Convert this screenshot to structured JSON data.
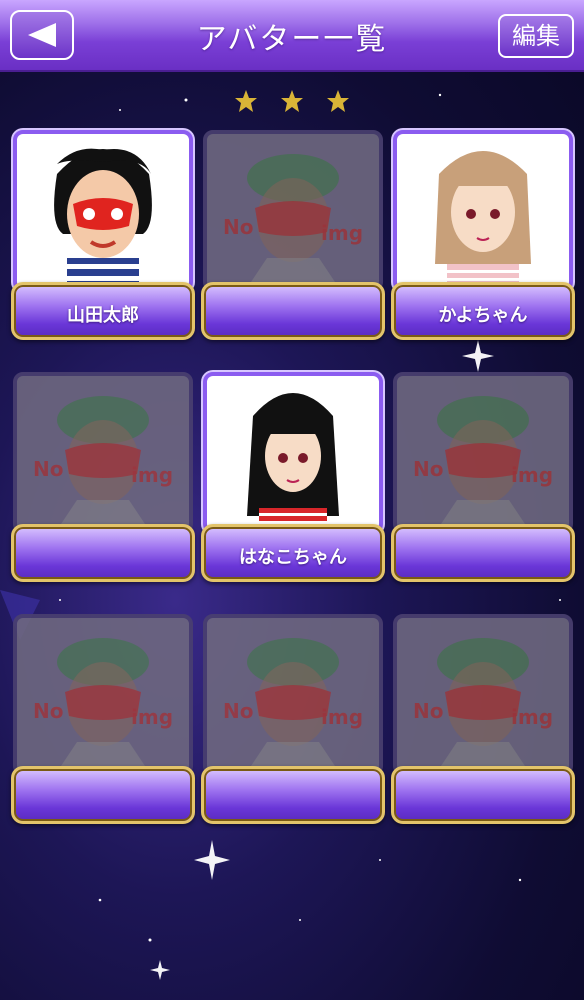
{
  "header": {
    "title": "アバター一覧",
    "back_icon": "left-arrow-icon",
    "edit_label": "編集"
  },
  "pagination": {
    "stars": [
      "star-icon",
      "star-icon",
      "star-icon"
    ]
  },
  "avatars": [
    {
      "label": "山田太郎",
      "state": "filled",
      "icon": "avatar-man-red-mask"
    },
    {
      "label": "",
      "state": "empty",
      "icon": "no-img-placeholder"
    },
    {
      "label": "かよちゃん",
      "state": "filled",
      "icon": "avatar-woman-long-hair"
    },
    {
      "label": "",
      "state": "empty",
      "icon": "no-img-placeholder"
    },
    {
      "label": "はなこちゃん",
      "state": "filled",
      "icon": "avatar-girl-black-hair"
    },
    {
      "label": "",
      "state": "empty",
      "icon": "no-img-placeholder"
    },
    {
      "label": "",
      "state": "empty",
      "icon": "no-img-placeholder"
    },
    {
      "label": "",
      "state": "empty",
      "icon": "no-img-placeholder"
    },
    {
      "label": "",
      "state": "empty",
      "icon": "no-img-placeholder"
    }
  ],
  "placeholder_text": "No img",
  "colors": {
    "header": "#7a3fd6",
    "plate_border": "#e3c46a",
    "card_border": "#8b5cf0",
    "background": "#1d1656"
  }
}
